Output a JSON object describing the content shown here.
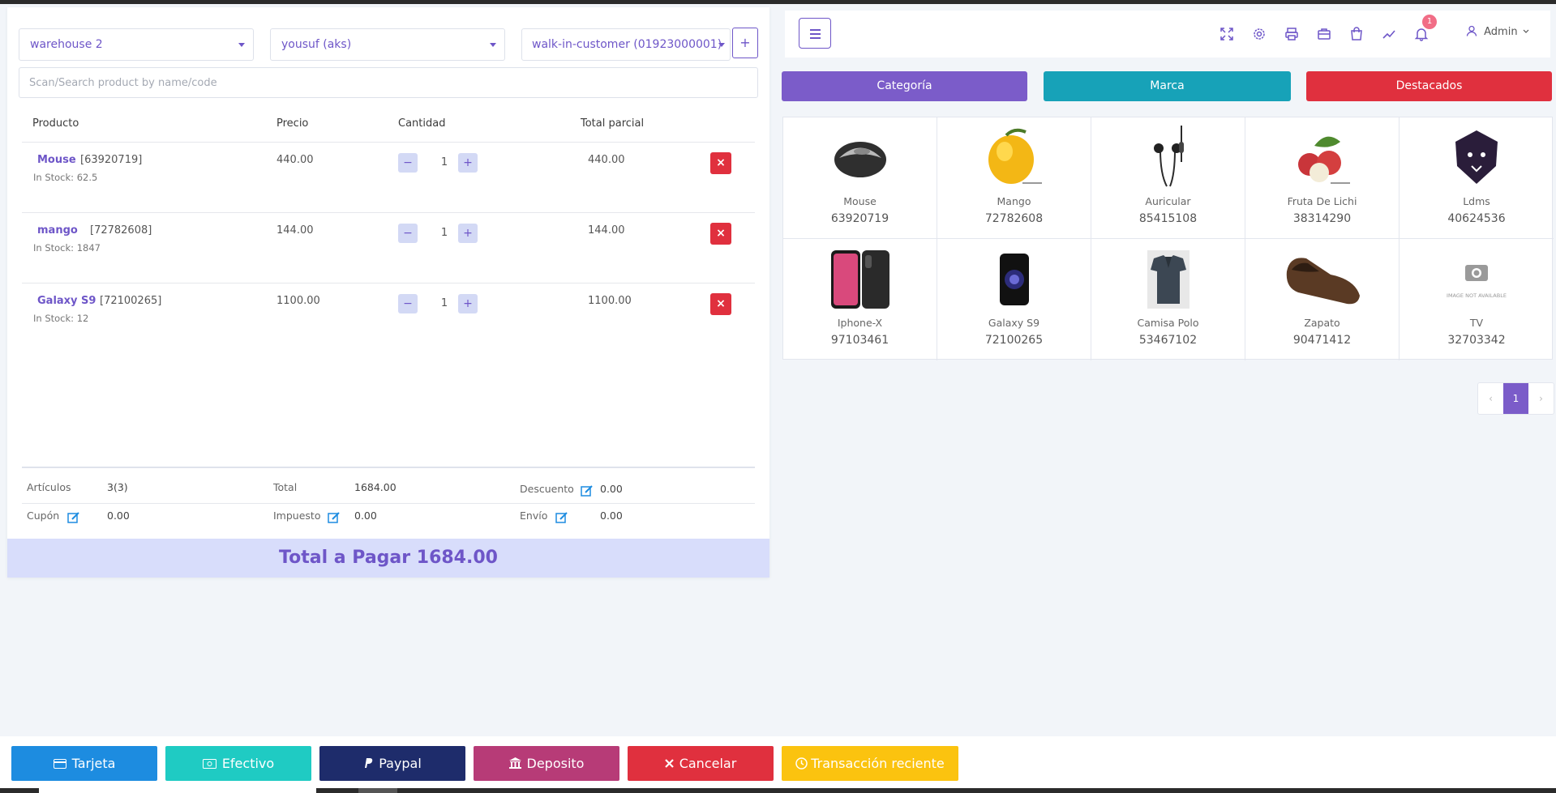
{
  "selectors": {
    "warehouse": "warehouse 2",
    "user": "yousuf (aks)",
    "customer": "walk-in-customer (01923000001)",
    "add_label": "+"
  },
  "search": {
    "placeholder": "Scan/Search product by name/code"
  },
  "table": {
    "headers": [
      "Producto",
      "Precio",
      "Cantidad",
      "Total parcial"
    ],
    "rows": [
      {
        "name": "Mouse",
        "code": "[63920719]",
        "stock": "In Stock: 62.5",
        "price": "440.00",
        "qty": "1",
        "subtotal": "440.00"
      },
      {
        "name": "mango",
        "code": "[72782608]",
        "stock": "In Stock: 1847",
        "price": "144.00",
        "qty": "1",
        "subtotal": "144.00"
      },
      {
        "name": "Galaxy S9",
        "code": "[72100265]",
        "stock": "In Stock: 12",
        "price": "1100.00",
        "qty": "1",
        "subtotal": "1100.00"
      }
    ],
    "minus": "−",
    "plus": "+",
    "remove": "×"
  },
  "summary": {
    "items_label": "Artículos",
    "items_value": "3(3)",
    "total_label": "Total",
    "total_value": "1684.00",
    "discount_label": "Descuento",
    "discount_value": "0.00",
    "coupon_label": "Cupón",
    "coupon_value": "0.00",
    "tax_label": "Impuesto",
    "tax_value": "0.00",
    "shipping_label": "Envío",
    "shipping_value": "0.00",
    "grand_total": "Total a Pagar 1684.00"
  },
  "header": {
    "notification_count": "1",
    "user_label": "Admin"
  },
  "category_buttons": {
    "category": "Categoría",
    "brand": "Marca",
    "featured": "Destacados",
    "colors": {
      "category": "#7b5cc9",
      "brand": "#17a2b8",
      "featured": "#e0303e"
    }
  },
  "products": [
    {
      "name": "Mouse",
      "code": "63920719",
      "image": "mouse"
    },
    {
      "name": "Mango",
      "code": "72782608",
      "image": "mango"
    },
    {
      "name": "Auricular",
      "code": "85415108",
      "image": "earphones"
    },
    {
      "name": "Fruta De Lichi",
      "code": "38314290",
      "image": "lychee"
    },
    {
      "name": "Ldms",
      "code": "40624536",
      "image": "lion-logo"
    },
    {
      "name": "Iphone-X",
      "code": "97103461",
      "image": "iphone"
    },
    {
      "name": "Galaxy S9",
      "code": "72100265",
      "image": "galaxy"
    },
    {
      "name": "Camisa Polo",
      "code": "53467102",
      "image": "polo-shirt"
    },
    {
      "name": "Zapato",
      "code": "90471412",
      "image": "shoe"
    },
    {
      "name": "TV",
      "code": "32703342",
      "image": "image-not-available"
    }
  ],
  "image_not_available_text": "IMAGE NOT AVAILABLE",
  "pagination": {
    "prev": "‹",
    "current": "1",
    "next": "›"
  },
  "payment_buttons": {
    "card": "Tarjeta",
    "cash": "Efectivo",
    "paypal": "Paypal",
    "deposit": "Deposito",
    "cancel": "Cancelar",
    "recent": "Transacción reciente",
    "colors": {
      "card": "#1d8ce0",
      "cash": "#1fcbc3",
      "paypal": "#1e2c6b",
      "deposit": "#b73b77",
      "cancel": "#e0303e",
      "recent": "#fbc30f"
    }
  }
}
